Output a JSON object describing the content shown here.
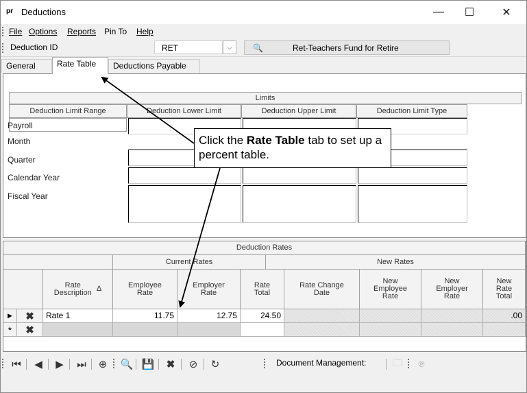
{
  "window": {
    "app_icon": "pr",
    "title": "Deductions",
    "controls": [
      "minimize-icon",
      "maximize-icon",
      "close-icon"
    ],
    "control_glyphs": [
      "—",
      "☐",
      "✕"
    ]
  },
  "menu": {
    "file": "File",
    "options": "Options",
    "reports": "Reports",
    "pin_to": "Pin To",
    "help": "Help"
  },
  "deduction_bar": {
    "label": "Deduction ID",
    "id_value": "RET",
    "description": "Ret-Teachers Fund for Retire"
  },
  "tabs": [
    {
      "label": "General"
    },
    {
      "label": "Rate Table",
      "active": true
    },
    {
      "label": "Deductions Payable"
    }
  ],
  "limits": {
    "title": "Limits",
    "headers": [
      "Deduction Limit Range",
      "Deduction Lower Limit",
      "Deduction Upper Limit",
      "Deduction Limit Type"
    ],
    "rows": [
      "Payroll",
      "Month",
      "Quarter",
      "Calendar Year",
      "Fiscal Year"
    ]
  },
  "rates": {
    "title": "Deduction Rates",
    "group_current": "Current Rates",
    "group_new": "New Rates",
    "col_rate_description": "Rate\nDescription",
    "sort_glyph": "Δ",
    "col_employee_rate": "Employee\nRate",
    "col_employer_rate": "Employer\nRate",
    "col_rate_total": "Rate\nTotal",
    "col_rate_change_date": "Rate Change\nDate",
    "col_new_employee_rate": "New\nEmployee\nRate",
    "col_new_employer_rate": "New\nEmployer\nRate",
    "col_new_rate_total": "New\nRate\nTotal",
    "row": {
      "description": "Rate 1",
      "employee_rate": "11.75",
      "employer_rate": "12.75",
      "rate_total": "24.50",
      "new_rate_total": ".00"
    }
  },
  "toolbar": {
    "document_management": "Document Management:"
  },
  "callout": {
    "prefix": "Click  the ",
    "bold": "Rate Table",
    "suffix": " tab to set up a percent table."
  }
}
